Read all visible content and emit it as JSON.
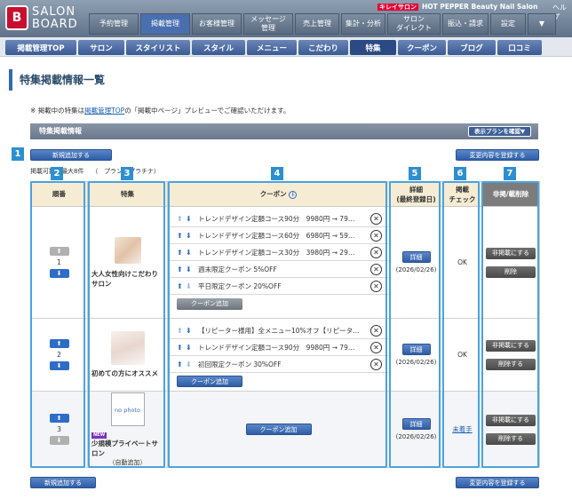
{
  "header": {
    "logo_mark": "B",
    "logo_line1": "SALON",
    "logo_line2": "BOARD",
    "hp_tag": "キレイサロン",
    "hp_text": "HOT PEPPER Beauty Nail Salon",
    "help": "ヘルプ",
    "nav": [
      "予約管理",
      "掲載管理",
      "お客様管理",
      "メッセージ\n管理",
      "売上管理",
      "集計・分析",
      "サロン\nダイレクト",
      "振込・請求",
      "設定",
      "▼"
    ]
  },
  "subnav": [
    "掲載管理TOP",
    "サロン",
    "スタイリスト",
    "スタイル",
    "メニュー",
    "こだわり",
    "特集",
    "クーポン",
    "ブログ",
    "口コミ"
  ],
  "page": {
    "title": "特集掲載情報一覧",
    "note_prefix": "※ 掲載中の特集は",
    "note_link": "掲載管理TOP",
    "note_suffix": "の「掲載中ページ」プレビューでご確認いただけます。",
    "section_title": "特集掲載情報",
    "plan_button": "表示プランを確認▼",
    "add_new": "新規追加する",
    "register_changes": "変更内容を登録する",
    "limit_info_left": "掲載可",
    "limit_info_mid": "数：最大8件",
    "limit_info_right": "（",
    "limit_info_plan": "プラン：プラチナ）"
  },
  "callouts": [
    "1",
    "2",
    "3",
    "4",
    "5",
    "6",
    "7"
  ],
  "table": {
    "headers": {
      "order": "順番",
      "feature": "特集",
      "coupon": "クーポン",
      "coupon_info_icon": "i",
      "detail_line1": "詳細",
      "detail_line2": "(最終登録日)",
      "check_line1": "掲載",
      "check_line2": "チェック",
      "action": "非掲/載削除"
    },
    "add_coupon": "クーポン追加",
    "detail_button": "詳細",
    "hide_button": "非掲載にする",
    "delete_button": "削除",
    "delete_do_button": "削除する",
    "up_glyph": "⬆",
    "down_glyph": "⬇",
    "rows": [
      {
        "order": "1",
        "feature_name": "大人女性向けこだわりサロン",
        "coupons": [
          {
            "text": "トレンドデザイン定額コース90分　9980円 → 79…",
            "up": false,
            "down": true
          },
          {
            "text": "トレンドデザイン定額コース60分　6980円 → 59…",
            "up": true,
            "down": true
          },
          {
            "text": "トレンドデザイン定額コース30分　3980円 → 29…",
            "up": true,
            "down": true
          },
          {
            "text": "週末限定クーポン 5%OFF",
            "up": true,
            "down": true
          },
          {
            "text": "平日限定クーポン 20%OFF",
            "up": true,
            "down": false
          }
        ],
        "detail_date": "(2026/02/26)",
        "check": "OK",
        "delete_label": "削除"
      },
      {
        "order": "2",
        "feature_name": "初めての方にオススメ",
        "coupons": [
          {
            "text": "【リピーター様用】全メニュー10%オフ【リピータ…",
            "up": false,
            "down": true
          },
          {
            "text": "トレンドデザイン定額コース90分　9980円 → 79…",
            "up": true,
            "down": true
          },
          {
            "text": "初回限定クーポン 30%OFF",
            "up": true,
            "down": false
          }
        ],
        "detail_date": "(2026/02/26)",
        "check": "OK",
        "delete_label": "削除する"
      },
      {
        "order": "3",
        "feature_name": "少規模プライベートサロン",
        "feature_sub": "（自動追加）",
        "new_badge": "NEW",
        "no_photo": "no photo",
        "coupons": [],
        "detail_date": "(2026/02/26)",
        "check": "未着手",
        "delete_label": "削除する"
      }
    ]
  },
  "colors": {
    "accent": "#2e8fd0",
    "header_bg": "#f6ecd4",
    "nav_blue": "#3a5a94"
  }
}
